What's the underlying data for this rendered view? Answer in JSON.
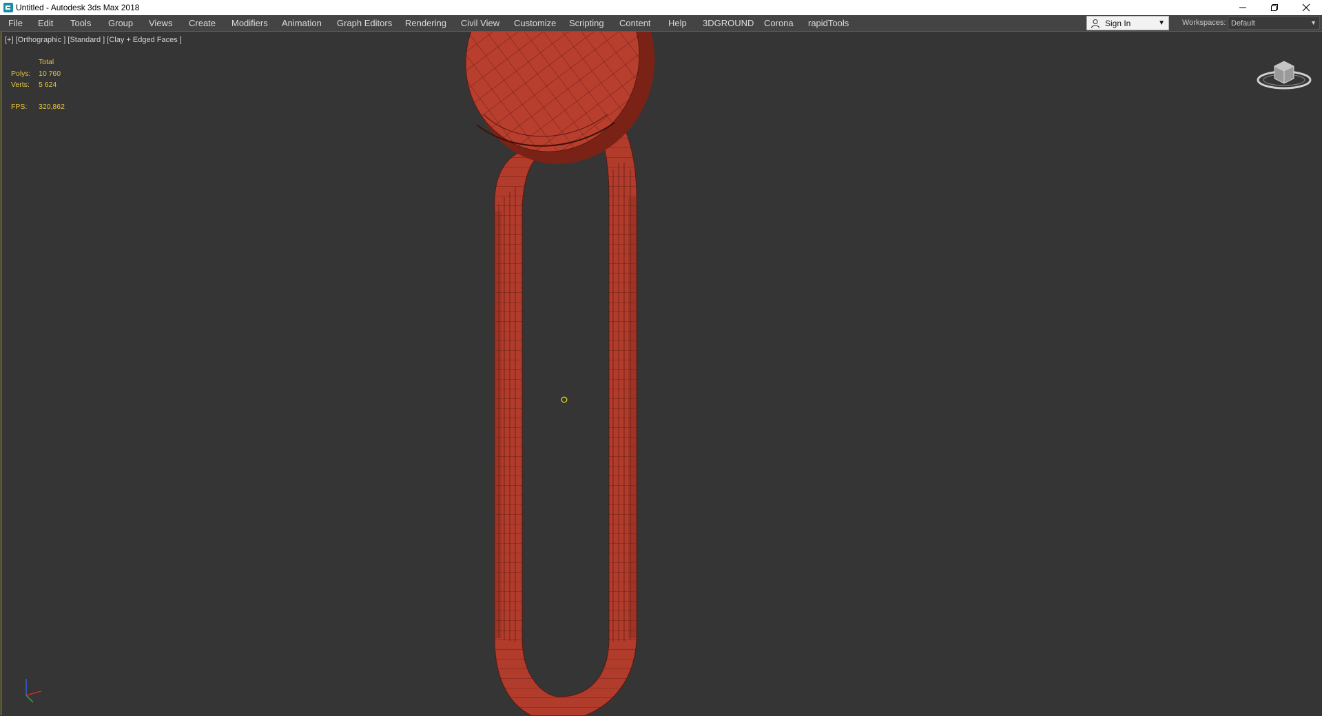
{
  "window": {
    "title": "Untitled - Autodesk 3ds Max 2018",
    "minimize_glyph": "─",
    "restore_glyph": "❐",
    "close_glyph": "✕"
  },
  "menu": {
    "items": [
      "File",
      "Edit",
      "Tools",
      "Group",
      "Views",
      "Create",
      "Modifiers",
      "Animation",
      "Graph Editors",
      "Rendering",
      "Civil View",
      "Customize",
      "Scripting",
      "Content",
      "Help",
      "3DGROUND",
      "Corona",
      "rapidTools"
    ]
  },
  "account": {
    "sign_in_label": "Sign In",
    "workspaces_label": "Workspaces:",
    "workspace_value": "Default"
  },
  "viewport": {
    "label": "[+] [Orthographic ] [Standard ] [Clay + Edged Faces ]",
    "stats": {
      "header": "Total",
      "polys_label": "Polys:",
      "polys_value": "10 760",
      "verts_label": "Verts:",
      "verts_value": "5 624",
      "fps_label": "FPS:",
      "fps_value": "320,862"
    }
  },
  "icons": {
    "app": "3ds-max-app-icon",
    "viewcube": "viewcube-icon",
    "axis": "axis-tripod-icon",
    "cursor": "pivot-cursor-icon",
    "user": "user-icon",
    "dropdown": "chevron-down-icon"
  },
  "colors": {
    "viewport_bg": "#353535",
    "menubar_bg": "#444444",
    "model_fill": "#b23c2c",
    "wire": "#5a1810",
    "stats_text": "#e8c53c",
    "active_border": "#b9b027"
  }
}
